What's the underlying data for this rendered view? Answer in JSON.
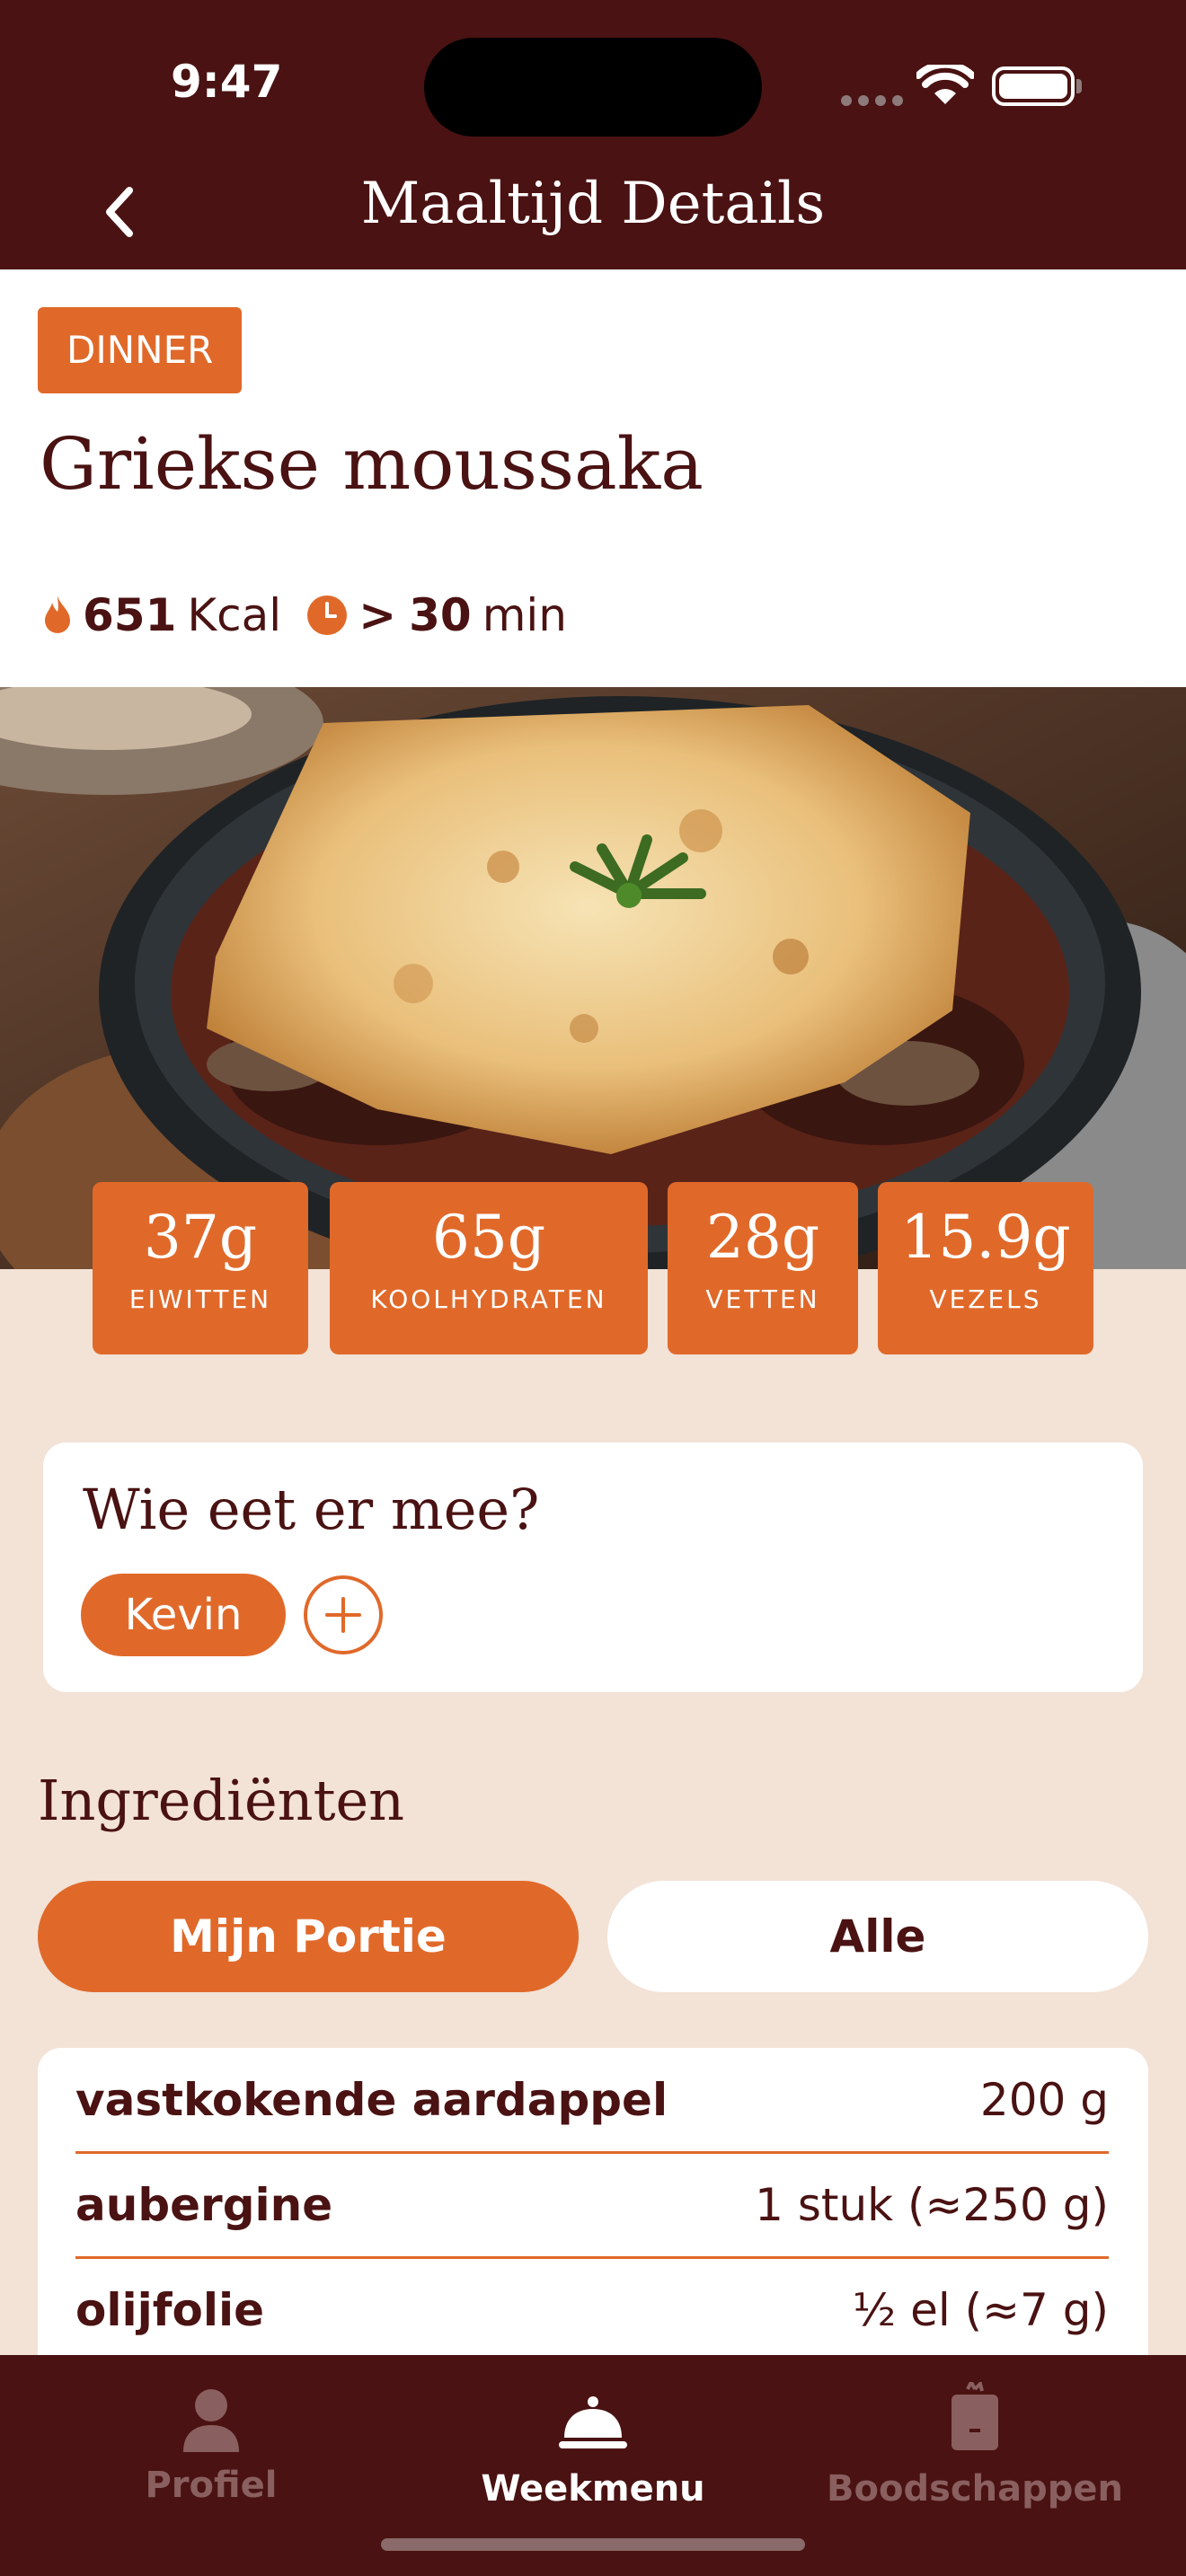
{
  "status_bar": {
    "time": "9:47"
  },
  "nav": {
    "title": "Maaltijd Details",
    "back_icon": "chevron-left-icon"
  },
  "meal": {
    "tag": "DINNER",
    "title": "Griekse moussaka",
    "kcal_value": "651",
    "kcal_unit": "Kcal",
    "time_prefix": ">",
    "time_value": "30",
    "time_unit": "min"
  },
  "macros": [
    {
      "value": "37g",
      "label": "EIWITTEN"
    },
    {
      "value": "65g",
      "label": "KOOLHYDRATEN"
    },
    {
      "value": "28g",
      "label": "VETTEN"
    },
    {
      "value": "15.9g",
      "label": "VEZELS"
    }
  ],
  "eaters": {
    "title": "Wie eet er mee?",
    "people": [
      "Kevin"
    ]
  },
  "ingredients": {
    "title": "Ingrediënten",
    "toggle_mine": "Mijn Portie",
    "toggle_all": "Alle",
    "items": [
      {
        "name": "vastkokende aardappel",
        "qty": "200 g"
      },
      {
        "name": "aubergine",
        "qty": "1 stuk (≈250 g)"
      },
      {
        "name": "olijfolie",
        "qty": "½ el (≈7 g)"
      }
    ]
  },
  "tabbar": {
    "items": [
      {
        "label": "Profiel",
        "icon": "person-icon",
        "active": false
      },
      {
        "label": "Weekmenu",
        "icon": "cloche-icon",
        "active": true
      },
      {
        "label": "Boodschappen",
        "icon": "grocery-bag-icon",
        "active": false
      }
    ]
  },
  "colors": {
    "primary": "#4A1212",
    "accent": "#E0692A",
    "background": "#F3E2D6",
    "card": "#FFFFFF"
  }
}
